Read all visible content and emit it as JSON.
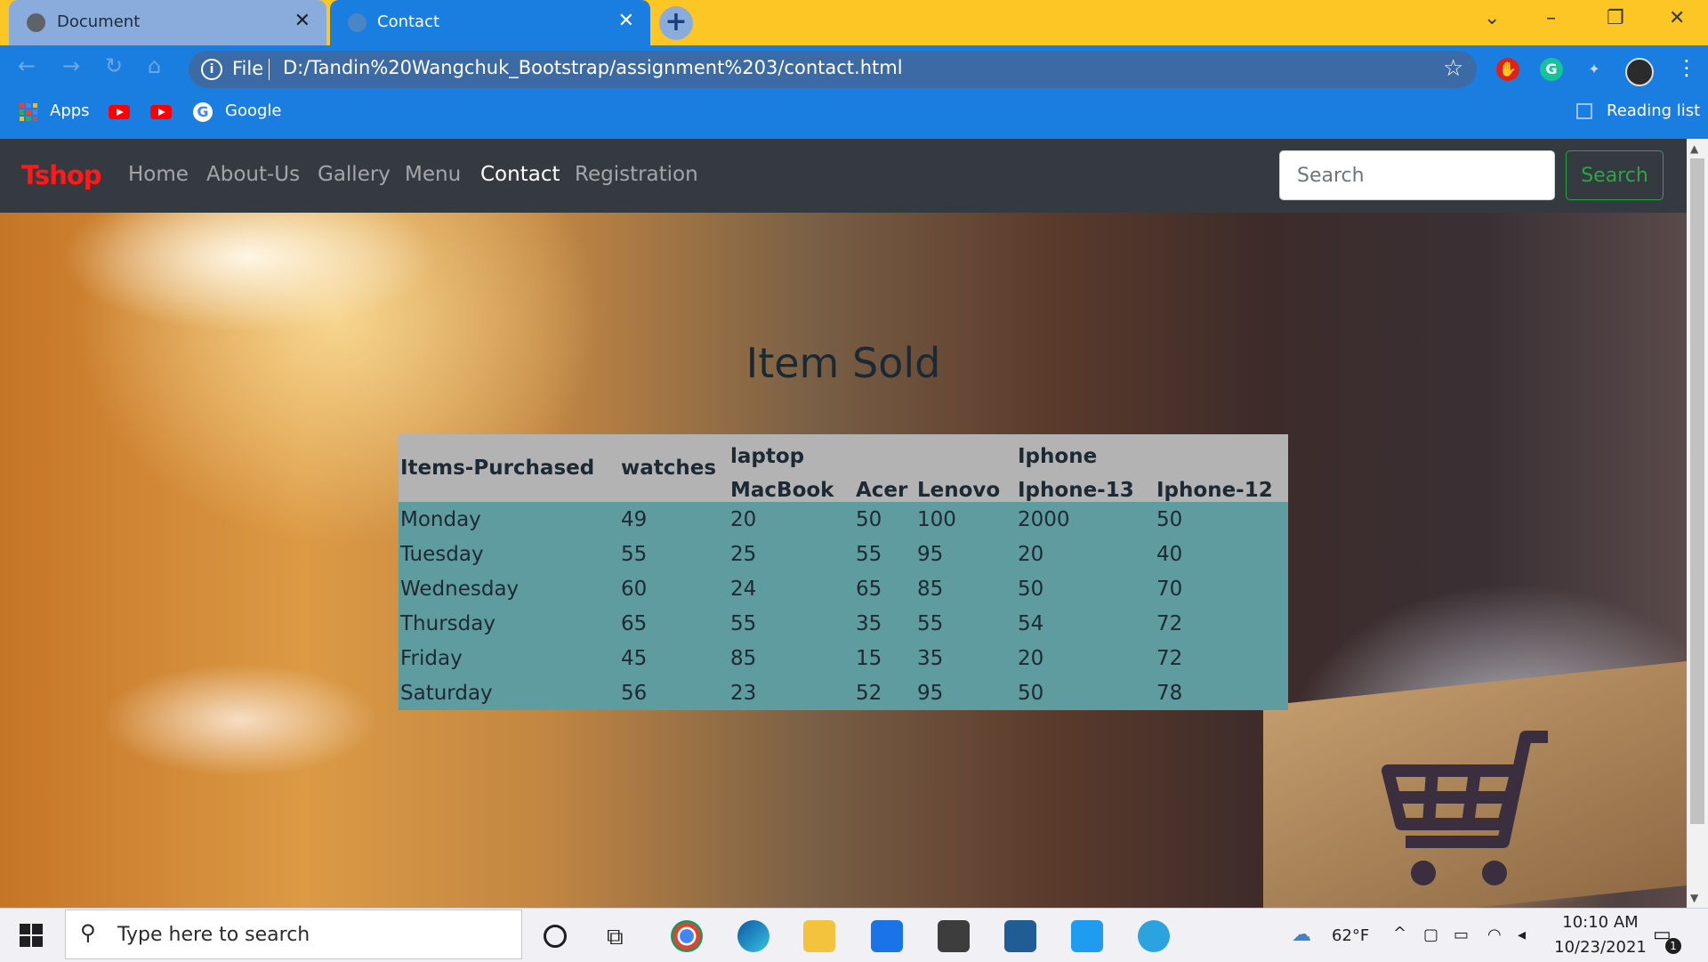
{
  "browser": {
    "tabs": [
      {
        "title": "Document",
        "active": false
      },
      {
        "title": "Contact",
        "active": true
      }
    ],
    "address": {
      "scheme_label": "File",
      "url": "D:/Tandin%20Wangchuk_Bootstrap/assignment%203/contact.html"
    },
    "bookmarks": [
      {
        "label": "Apps",
        "icon": "apps-grid-icon"
      },
      {
        "label": "",
        "icon": "youtube-icon"
      },
      {
        "label": "",
        "icon": "youtube-icon"
      },
      {
        "label": "Google",
        "icon": "google-icon"
      }
    ],
    "reading_list": "Reading list",
    "accent": "#1a7de0",
    "tabstrip_color": "#fcc624"
  },
  "navbar": {
    "brand": "Tshop",
    "links": [
      {
        "label": "Home",
        "active": false
      },
      {
        "label": "About-Us",
        "active": false
      },
      {
        "label": "Gallery",
        "active": false
      },
      {
        "label": "Menu",
        "active": false
      },
      {
        "label": "Contact",
        "active": true
      },
      {
        "label": "Registration",
        "active": false
      }
    ],
    "search": {
      "placeholder": "Search",
      "button": "Search"
    }
  },
  "main": {
    "heading": "Item Sold",
    "table": {
      "headers": {
        "items": "Items-Purchased",
        "watches": "watches",
        "laptop": "laptop",
        "iphone": "Iphone",
        "macbook": "MacBook",
        "acer": "Acer",
        "lenovo": "Lenovo",
        "iphone13": "Iphone-13",
        "iphone12": "Iphone-12"
      },
      "rows": [
        [
          "Monday",
          "49",
          "20",
          "50",
          "100",
          "2000",
          "50"
        ],
        [
          "Tuesday",
          "55",
          "25",
          "55",
          "95",
          "20",
          "40"
        ],
        [
          "Wednesday",
          "60",
          "24",
          "65",
          "85",
          "50",
          "70"
        ],
        [
          "Thursday",
          "65",
          "55",
          "35",
          "55",
          "54",
          "72"
        ],
        [
          "Friday",
          "45",
          "85",
          "15",
          "35",
          "20",
          "72"
        ],
        [
          "Saturday",
          "56",
          "23",
          "52",
          "95",
          "50",
          "78"
        ]
      ]
    }
  },
  "taskbar": {
    "search_placeholder": "Type here to search",
    "weather": "62°F",
    "time": "10:10 AM",
    "date": "10/23/2021",
    "notification_count": "1"
  }
}
